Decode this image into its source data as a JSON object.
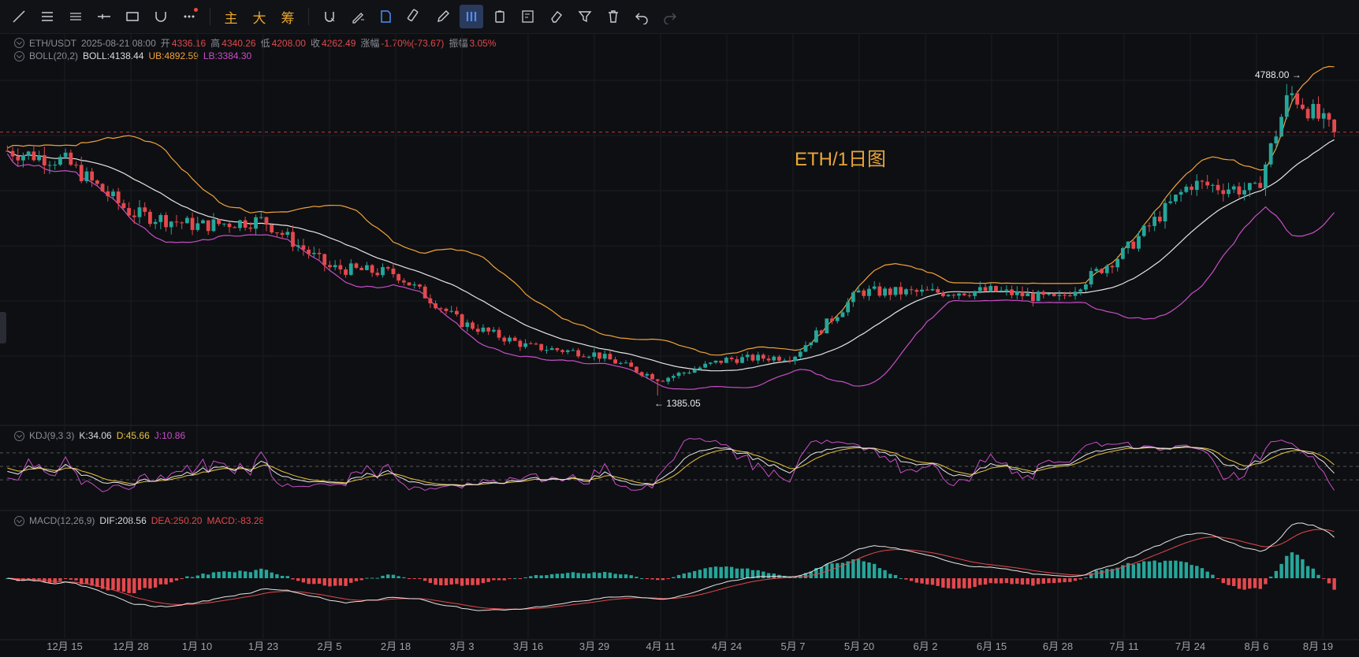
{
  "toolbar": {
    "left_tools": [
      "trend-line-tool",
      "horizontal-lines-tool",
      "parallel-lines-tool",
      "horizontal-ray-tool",
      "rectangle-tool",
      "curve-tool",
      "more-tools"
    ],
    "cn_buttons": [
      "主",
      "大",
      "筹"
    ],
    "right_tools": [
      "magnet-tool",
      "draw-settings-tool",
      "auto-fib-tool",
      "measure-tool",
      "pencil-tool",
      "indicator-bars-tool",
      "clipboard-tool",
      "edit-list-tool",
      "eraser-tool",
      "filter-tool",
      "delete-tool",
      "undo-tool",
      "redo-tool"
    ]
  },
  "header": {
    "symbol": "ETH/USDT",
    "datetime": "2025-08-21 08:00",
    "open_label": "开",
    "open": "4336.16",
    "high_label": "高",
    "high": "4340.26",
    "low_label": "低",
    "low": "4208.00",
    "close_label": "收",
    "close": "4262.49",
    "change_label": "涨幅",
    "change": "-1.70%(-73.67)",
    "amp_label": "振幅",
    "amp": "3.05%"
  },
  "boll": {
    "name": "BOLL(20,2)",
    "mid": "BOLL:4138.44",
    "ub": "UB:4892.59",
    "lb": "LB:3384.30"
  },
  "kdj": {
    "name": "KDJ(9,3,3)",
    "k": "K:34.06",
    "d": "D:45.66",
    "j": "J:10.86"
  },
  "macd": {
    "name": "MACD(12,26,9)",
    "dif": "DIF:208.56",
    "dea": "DEA:250.20",
    "macd": "MACD:-83.28"
  },
  "watermark": "ETH/1日图",
  "annotations": {
    "high": "4788.00",
    "low": "1385.05"
  },
  "x_axis": [
    "12月 15",
    "12月 28",
    "1月 10",
    "1月 23",
    "2月 5",
    "2月 18",
    "3月 3",
    "3月 16",
    "3月 29",
    "4月 11",
    "4月 24",
    "5月 7",
    "5月 20",
    "6月 2",
    "6月 15",
    "6月 28",
    "7月 11",
    "7月 24",
    "8月 6",
    "8月 19"
  ],
  "colors": {
    "up": "#26a69a",
    "down": "#e5484d",
    "ub": "#f0a23a",
    "mid": "#e6e6e6",
    "lb": "#c74ec8",
    "k": "#e6e6e6",
    "d": "#e9c43f",
    "j": "#c74ec8",
    "dif": "#e6e6e6",
    "dea": "#e5484d"
  },
  "chart_data": {
    "type": "candlestick",
    "symbol": "ETH/USDT",
    "close_anchors": [
      [
        "12月 15",
        3950
      ],
      [
        "12月 28",
        3380
      ],
      [
        "1月 10",
        3240
      ],
      [
        "1月 23",
        3300
      ],
      [
        "2月 5",
        2780
      ],
      [
        "2月 18",
        2720
      ],
      [
        "3月 3",
        2180
      ],
      [
        "3月 16",
        1920
      ],
      [
        "3月 29",
        1840
      ],
      [
        "4月 11",
        1560
      ],
      [
        "4月 24",
        1780
      ],
      [
        "5月 7",
        1810
      ],
      [
        "5月 20",
        2520
      ],
      [
        "6月 2",
        2510
      ],
      [
        "6月 15",
        2530
      ],
      [
        "6月 28",
        2430
      ],
      [
        "7月 11",
        2950
      ],
      [
        "7月 24",
        3700
      ],
      [
        "8月 6",
        3620
      ],
      [
        "8月 13",
        4700
      ],
      [
        "8月 19",
        4262.49
      ]
    ],
    "marked_high": 4788.0,
    "marked_low": 1385.05,
    "last_close": 4262.49
  }
}
